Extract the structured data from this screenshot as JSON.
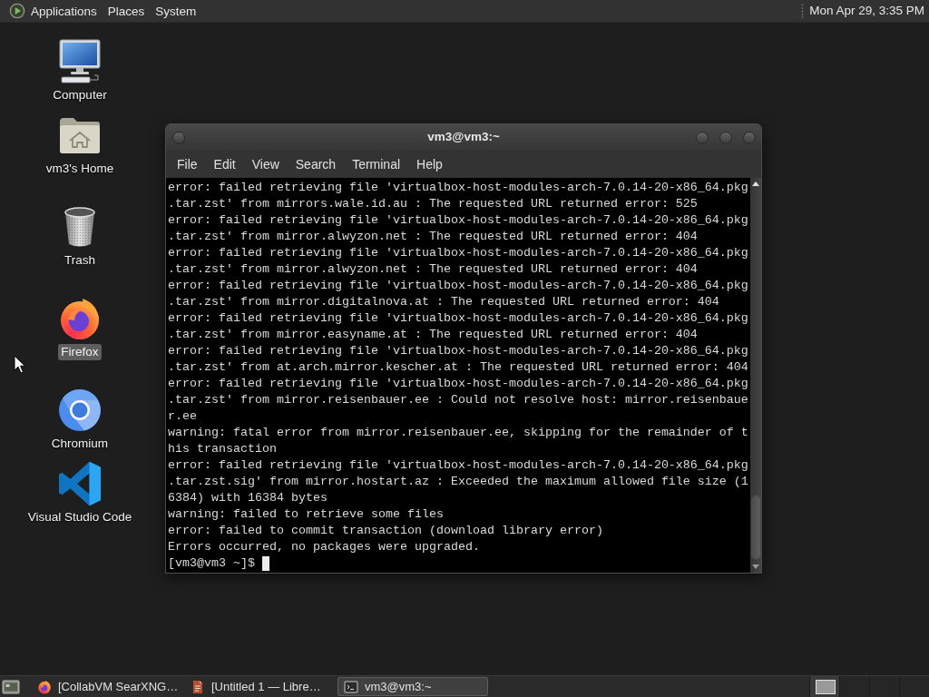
{
  "top_panel": {
    "menus": [
      "Applications",
      "Places",
      "System"
    ],
    "clock": "Mon Apr 29, 3:35 PM"
  },
  "desktop_icons": [
    {
      "label": "Computer",
      "kind": "computer",
      "selected": false
    },
    {
      "label": "vm3's Home",
      "kind": "home",
      "selected": false
    },
    {
      "label": "Trash",
      "kind": "trash",
      "selected": false
    },
    {
      "label": "Firefox",
      "kind": "firefox",
      "selected": true
    },
    {
      "label": "Chromium",
      "kind": "chromium",
      "selected": false
    },
    {
      "label": "Visual Studio Code",
      "kind": "vscode",
      "selected": false
    }
  ],
  "terminal_window": {
    "title": "vm3@vm3:~",
    "menu": [
      "File",
      "Edit",
      "View",
      "Search",
      "Terminal",
      "Help"
    ],
    "lines": [
      "error: failed retrieving file 'virtualbox-host-modules-arch-7.0.14-20-x86_64.pkg",
      ".tar.zst' from mirrors.wale.id.au : The requested URL returned error: 525",
      "error: failed retrieving file 'virtualbox-host-modules-arch-7.0.14-20-x86_64.pkg",
      ".tar.zst' from mirror.alwyzon.net : The requested URL returned error: 404",
      "error: failed retrieving file 'virtualbox-host-modules-arch-7.0.14-20-x86_64.pkg",
      ".tar.zst' from mirror.alwyzon.net : The requested URL returned error: 404",
      "error: failed retrieving file 'virtualbox-host-modules-arch-7.0.14-20-x86_64.pkg",
      ".tar.zst' from mirror.digitalnova.at : The requested URL returned error: 404",
      "error: failed retrieving file 'virtualbox-host-modules-arch-7.0.14-20-x86_64.pkg",
      ".tar.zst' from mirror.easyname.at : The requested URL returned error: 404",
      "error: failed retrieving file 'virtualbox-host-modules-arch-7.0.14-20-x86_64.pkg",
      ".tar.zst' from at.arch.mirror.kescher.at : The requested URL returned error: 404",
      "error: failed retrieving file 'virtualbox-host-modules-arch-7.0.14-20-x86_64.pkg",
      ".tar.zst' from mirror.reisenbauer.ee : Could not resolve host: mirror.reisenbaue",
      "r.ee",
      "warning: fatal error from mirror.reisenbauer.ee, skipping for the remainder of t",
      "his transaction",
      "error: failed retrieving file 'virtualbox-host-modules-arch-7.0.14-20-x86_64.pkg",
      ".tar.zst.sig' from mirror.hostart.az : Exceeded the maximum allowed file size (1",
      "6384) with 16384 bytes",
      "warning: failed to retrieve some files",
      "error: failed to commit transaction (download library error)",
      "Errors occurred, no packages were upgraded."
    ],
    "prompt": "[vm3@vm3 ~]$"
  },
  "taskbar": {
    "windows": [
      {
        "title": "[CollabVM SearXNG…",
        "kind": "browser",
        "selected": false
      },
      {
        "title": "[Untitled 1 — Libre…",
        "kind": "document",
        "selected": false
      },
      {
        "title": "vm3@vm3:~",
        "kind": "terminal",
        "selected": true
      }
    ],
    "workspaces": [
      {
        "selected": true
      },
      {
        "selected": false
      },
      {
        "selected": false
      },
      {
        "selected": false
      }
    ]
  }
}
